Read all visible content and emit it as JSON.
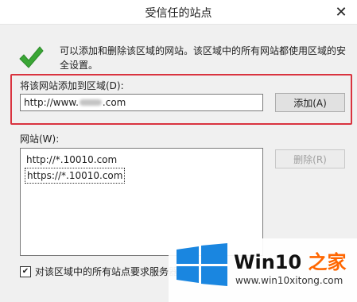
{
  "window": {
    "title": "受信任的站点",
    "close_glyph": "✕"
  },
  "description": "可以添加和删除该区域的网站。该区域中的所有网站都使用区域的安全设置。",
  "add_section": {
    "label": "将该网站添加到区域(D):",
    "input_prefix": "http://www.",
    "input_suffix": "123.com",
    "input_suffix_tail": ".com",
    "add_button": "添加(A)"
  },
  "sites_section": {
    "label": "网站(W):",
    "items": [
      {
        "text": "http://*.10010.com",
        "selected": false
      },
      {
        "text": "https://*.10010.com",
        "selected": true
      }
    ],
    "delete_button": "删除(R)"
  },
  "require_https": {
    "checked": true,
    "label": "对该区域中的所有站点要求服务器"
  },
  "watermark": {
    "title_main": "Win10 ",
    "title_accent": "之家",
    "url": "www.win10xitong.com"
  },
  "colors": {
    "highlight": "#d9333f",
    "check": "#3aa635",
    "win_blue": "#1a86e0",
    "accent": "#ff6600"
  },
  "icons": {
    "check": "checkmark-icon",
    "close": "close-icon",
    "logo": "windows-logo-icon"
  }
}
